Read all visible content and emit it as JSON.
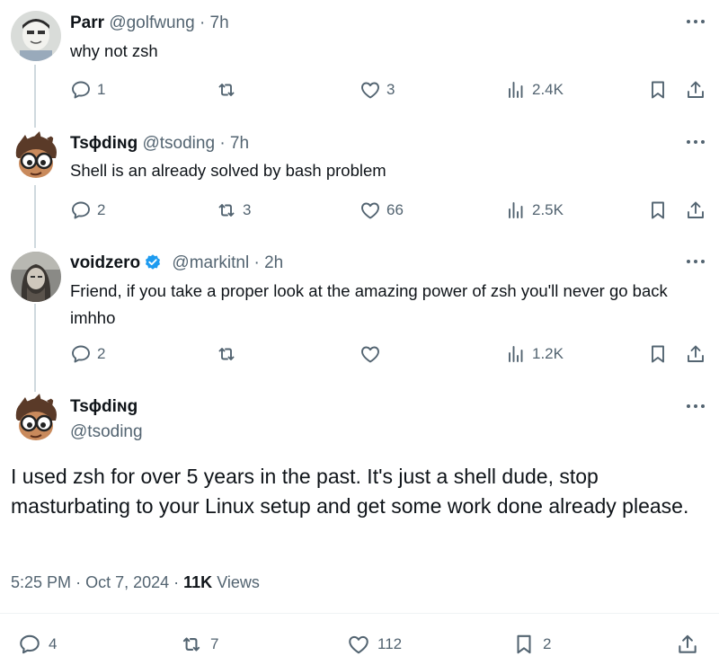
{
  "replies": [
    {
      "display_name": "Parr",
      "handle": "@golfwung",
      "time": "· 7h",
      "text": "why not zsh",
      "replies": "1",
      "reposts": "",
      "likes": "3",
      "views": "2.4K"
    },
    {
      "display_name": "Tsɸdiɴg",
      "handle": "@tsoding",
      "time": "· 7h",
      "text": "Shell is an already solved by bash problem",
      "replies": "2",
      "reposts": "3",
      "likes": "66",
      "views": "2.5K"
    },
    {
      "display_name": "voidzero",
      "handle": "@markitnl",
      "time": "· 2h",
      "text": "Friend, if you take a proper look at the amazing power of zsh you'll never go back imhho",
      "replies": "2",
      "reposts": "",
      "likes": "",
      "views": "1.2K"
    }
  ],
  "main_post": {
    "display_name": "Tsɸdiɴg",
    "handle": "@tsoding",
    "text": "I used zsh for over 5 years in the past. It's just a shell dude, stop masturbating to your Linux setup and get some work done already please.",
    "time": "5:25 PM",
    "date": "Oct 7, 2024",
    "views_count": "11K",
    "views_label": "Views",
    "replies": "4",
    "reposts": "7",
    "likes": "112",
    "bookmarks": "2"
  },
  "colors": {
    "text": "#0f1419",
    "muted": "#536471",
    "verified": "#1d9bf0",
    "thread_line": "#cfd9de"
  },
  "icons": [
    "reply-icon",
    "repost-icon",
    "like-icon",
    "views-icon",
    "bookmark-icon",
    "share-icon",
    "more-icon",
    "verified-icon"
  ]
}
